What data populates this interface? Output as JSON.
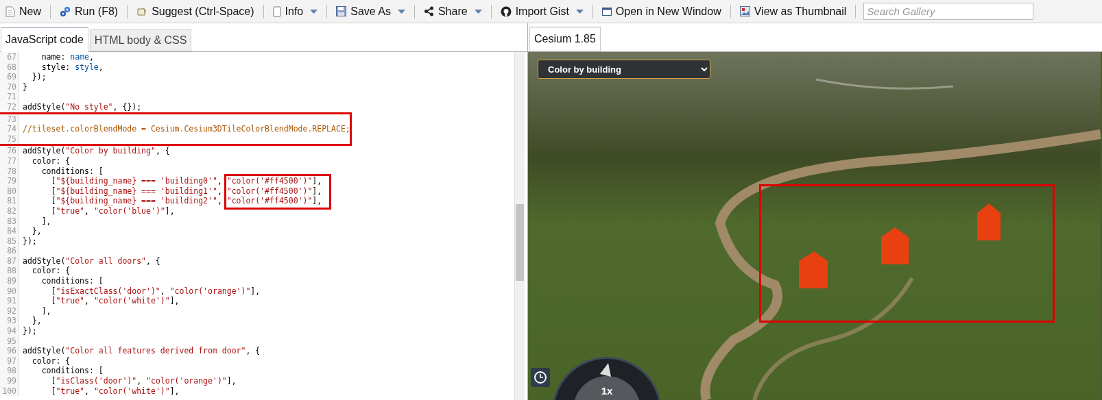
{
  "toolbar": [
    {
      "label": "New",
      "dropdown": false
    },
    {
      "label": "Run (F8)",
      "dropdown": false
    },
    {
      "label": "Suggest (Ctrl-Space)",
      "dropdown": false
    },
    {
      "label": "Info",
      "dropdown": true
    },
    {
      "label": "Save As",
      "dropdown": true
    },
    {
      "label": "Share",
      "dropdown": true
    },
    {
      "label": "Import Gist",
      "dropdown": true
    },
    {
      "label": "Open in New Window",
      "dropdown": false
    },
    {
      "label": "View as Thumbnail",
      "dropdown": false
    }
  ],
  "search": {
    "placeholder": "Search Gallery"
  },
  "editor_tabs": [
    {
      "label": "JavaScript code",
      "selected": true
    },
    {
      "label": "HTML body & CSS",
      "selected": false
    }
  ],
  "code_lines": [
    {
      "number": "67",
      "segments": [
        {
          "kind": "plain",
          "text": "    name: "
        },
        {
          "kind": "var",
          "text": "name"
        },
        {
          "kind": "plain",
          "text": ","
        }
      ]
    },
    {
      "number": "68",
      "segments": [
        {
          "kind": "plain",
          "text": "    style: "
        },
        {
          "kind": "var",
          "text": "style"
        },
        {
          "kind": "plain",
          "text": ","
        }
      ]
    },
    {
      "number": "69",
      "segments": [
        {
          "kind": "plain",
          "text": "  });"
        }
      ]
    },
    {
      "number": "70",
      "segments": [
        {
          "kind": "plain",
          "text": "}"
        }
      ]
    },
    {
      "number": "71"
    },
    {
      "number": "72",
      "segments": [
        {
          "kind": "plain",
          "text": "addStyle("
        },
        {
          "kind": "string",
          "text": "\"No style\""
        },
        {
          "kind": "plain",
          "text": ", {});"
        }
      ]
    },
    {
      "number": "73",
      "boxed": true
    },
    {
      "number": "74",
      "boxed": true,
      "segments": [
        {
          "kind": "comment",
          "text": "//tileset.colorBlendMode = Cesium.Cesium3DTileColorBlendMode.REPLACE;"
        }
      ]
    },
    {
      "number": "75",
      "boxed": true
    },
    {
      "number": "76",
      "segments": [
        {
          "kind": "plain",
          "text": "addStyle("
        },
        {
          "kind": "string",
          "text": "\"Color by building\""
        },
        {
          "kind": "plain",
          "text": ", {"
        }
      ]
    },
    {
      "number": "77",
      "segments": [
        {
          "kind": "plain",
          "text": "  color: {"
        }
      ]
    },
    {
      "number": "78",
      "segments": [
        {
          "kind": "plain",
          "text": "    conditions: ["
        }
      ]
    },
    {
      "number": "79",
      "segments": [
        {
          "kind": "plain",
          "text": "      ["
        },
        {
          "kind": "string",
          "text": "\"${building_name} === 'building0'\""
        },
        {
          "kind": "plain",
          "text": ", "
        },
        {
          "kind": "string",
          "text": "\"color('#ff4500')\"",
          "boxed": true
        },
        {
          "kind": "plain",
          "text": "],"
        }
      ]
    },
    {
      "number": "80",
      "segments": [
        {
          "kind": "plain",
          "text": "      ["
        },
        {
          "kind": "string",
          "text": "\"${building_name} === 'building1'\""
        },
        {
          "kind": "plain",
          "text": ", "
        },
        {
          "kind": "string",
          "text": "\"color('#ff4500')\"",
          "boxed": true
        },
        {
          "kind": "plain",
          "text": "],"
        }
      ]
    },
    {
      "number": "81",
      "segments": [
        {
          "kind": "plain",
          "text": "      ["
        },
        {
          "kind": "string",
          "text": "\"${building_name} === 'building2'\""
        },
        {
          "kind": "plain",
          "text": ", "
        },
        {
          "kind": "string",
          "text": "\"color('#ff4500')\"",
          "boxed": true
        },
        {
          "kind": "plain",
          "text": "],"
        }
      ]
    },
    {
      "number": "82",
      "segments": [
        {
          "kind": "plain",
          "text": "      ["
        },
        {
          "kind": "string",
          "text": "\"true\""
        },
        {
          "kind": "plain",
          "text": ", "
        },
        {
          "kind": "string",
          "text": "\"color('blue')\""
        },
        {
          "kind": "plain",
          "text": "],"
        }
      ]
    },
    {
      "number": "83",
      "segments": [
        {
          "kind": "plain",
          "text": "    ],"
        }
      ]
    },
    {
      "number": "84",
      "segments": [
        {
          "kind": "plain",
          "text": "  },"
        }
      ]
    },
    {
      "number": "85",
      "segments": [
        {
          "kind": "plain",
          "text": "});"
        }
      ]
    },
    {
      "number": "86"
    },
    {
      "number": "87",
      "segments": [
        {
          "kind": "plain",
          "text": "addStyle("
        },
        {
          "kind": "string",
          "text": "\"Color all doors\""
        },
        {
          "kind": "plain",
          "text": ", {"
        }
      ]
    },
    {
      "number": "88",
      "segments": [
        {
          "kind": "plain",
          "text": "  color: {"
        }
      ]
    },
    {
      "number": "89",
      "segments": [
        {
          "kind": "plain",
          "text": "    conditions: ["
        }
      ]
    },
    {
      "number": "90",
      "segments": [
        {
          "kind": "plain",
          "text": "      ["
        },
        {
          "kind": "string",
          "text": "\"isExactClass('door')\""
        },
        {
          "kind": "plain",
          "text": ", "
        },
        {
          "kind": "string",
          "text": "\"color('orange')\""
        },
        {
          "kind": "plain",
          "text": "],"
        }
      ]
    },
    {
      "number": "91",
      "segments": [
        {
          "kind": "plain",
          "text": "      ["
        },
        {
          "kind": "string",
          "text": "\"true\""
        },
        {
          "kind": "plain",
          "text": ", "
        },
        {
          "kind": "string",
          "text": "\"color('white')\""
        },
        {
          "kind": "plain",
          "text": "],"
        }
      ]
    },
    {
      "number": "92",
      "segments": [
        {
          "kind": "plain",
          "text": "    ],"
        }
      ]
    },
    {
      "number": "93",
      "segments": [
        {
          "kind": "plain",
          "text": "  },"
        }
      ]
    },
    {
      "number": "94",
      "segments": [
        {
          "kind": "plain",
          "text": "});"
        }
      ]
    },
    {
      "number": "95"
    },
    {
      "number": "96",
      "segments": [
        {
          "kind": "plain",
          "text": "addStyle("
        },
        {
          "kind": "string",
          "text": "\"Color all features derived from door\""
        },
        {
          "kind": "plain",
          "text": ", {"
        }
      ]
    },
    {
      "number": "97",
      "segments": [
        {
          "kind": "plain",
          "text": "  color: {"
        }
      ]
    },
    {
      "number": "98",
      "segments": [
        {
          "kind": "plain",
          "text": "    conditions: ["
        }
      ]
    },
    {
      "number": "99",
      "segments": [
        {
          "kind": "plain",
          "text": "      ["
        },
        {
          "kind": "string",
          "text": "\"isClass('door')\""
        },
        {
          "kind": "plain",
          "text": ", "
        },
        {
          "kind": "string",
          "text": "\"color('orange')\""
        },
        {
          "kind": "plain",
          "text": "],"
        }
      ]
    },
    {
      "number": "100",
      "segments": [
        {
          "kind": "plain",
          "text": "      ["
        },
        {
          "kind": "string",
          "text": "\"true\""
        },
        {
          "kind": "plain",
          "text": ", "
        },
        {
          "kind": "string",
          "text": "\"color('white')\""
        },
        {
          "kind": "plain",
          "text": "],"
        }
      ]
    }
  ],
  "viewer_tabs": [
    {
      "label": "Cesium 1.85",
      "selected": true
    }
  ],
  "viewer": {
    "style_select": {
      "value": "Color by building"
    },
    "animation_speed": "1x"
  }
}
